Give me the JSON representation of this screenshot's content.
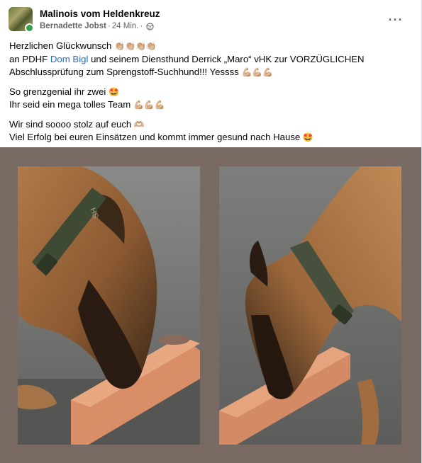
{
  "post": {
    "group_name": "Malinois vom Heldenkreuz",
    "author": "Bernadette Jobst",
    "separator": "·",
    "time": "24 Min.",
    "time_separator": "·",
    "privacy_icon": "globe-icon",
    "more_icon": "more-options-icon",
    "more_label": "···"
  },
  "content": {
    "l1_text": "Herzlichen Glückwunsch ",
    "l1_emoji": "👏🏼👏🏼👏🏼👏🏼",
    "l2_pre": "an PDHF ",
    "l2_mention": "Dom Bigl",
    "l2_post": " und seinem Diensthund Derrick „Maro“ vHK zur VORZÜGLICHEN",
    "l3_text": "Abschlussprüfung zum Sprengstoff-Suchhund!!! Yessss ",
    "l3_emoji": "💪🏼💪🏼💪🏼",
    "l4_text": "So grenzgenial ihr zwei ",
    "l4_emoji": "🤩",
    "l5_text": "Ihr seid ein mega tolles Team ",
    "l5_emoji": "💪🏼💪🏼💪🏼",
    "l6_text": "Wir sind soooo stolz auf euch ",
    "l6_emoji": "🫶🏼",
    "l7_text": "Viel Erfolg bei euren Einsätzen und kommt immer gesund nach Hause ",
    "l7_emoji": "🤩"
  },
  "media": {
    "photos": [
      {
        "subject": "malinois-dog-sniffing-brick-left",
        "collar_text": "HS"
      },
      {
        "subject": "malinois-dog-sniffing-brick-right"
      }
    ],
    "colors": {
      "frame": "#786a63",
      "mention": "#216fdb"
    }
  }
}
